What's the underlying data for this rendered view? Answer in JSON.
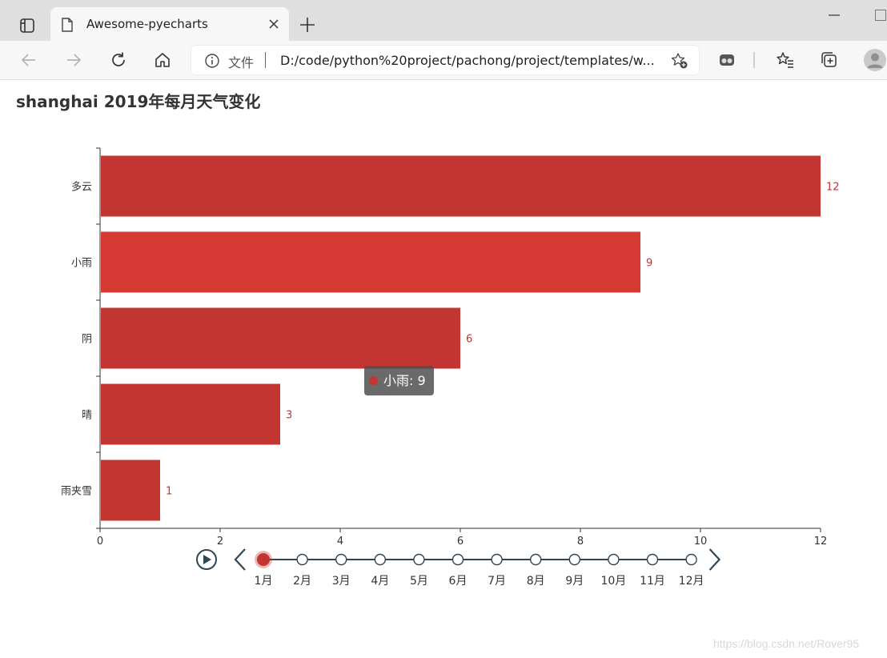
{
  "browser": {
    "tab_title": "Awesome-pyecharts",
    "address_scheme": "文件",
    "address_url": "D:/code/python%20project/pachong/project/templates/w..."
  },
  "page": {
    "title": "shanghai 2019年每月天气变化"
  },
  "chart_data": {
    "type": "bar",
    "orientation": "horizontal",
    "title": "shanghai 2019年每月天气变化",
    "categories": [
      "雨夹雪",
      "晴",
      "阴",
      "小雨",
      "多云"
    ],
    "series": [
      {
        "values": [
          1,
          3,
          6,
          9,
          12
        ]
      }
    ],
    "xlim": [
      0,
      12
    ],
    "x_ticks": [
      "0",
      "2",
      "4",
      "6",
      "8",
      "10",
      "12"
    ],
    "grid": false,
    "value_labels": true,
    "colors": {
      "bar": "#c23531",
      "bar_highlight": "#d63a35",
      "label": "#c23531",
      "axis": "#333333"
    }
  },
  "tooltip": {
    "category": "小雨",
    "value": "9",
    "text": "小雨: 9",
    "dot_color": "#c23531"
  },
  "timeline": {
    "labels": [
      "1月",
      "2月",
      "3月",
      "4月",
      "5月",
      "6月",
      "7月",
      "8月",
      "9月",
      "10月",
      "11月",
      "12月"
    ],
    "current_index": 0,
    "colors": {
      "line": "#304654",
      "active": "#c23531"
    }
  },
  "watermark": "https://blog.csdn.net/Rover95"
}
